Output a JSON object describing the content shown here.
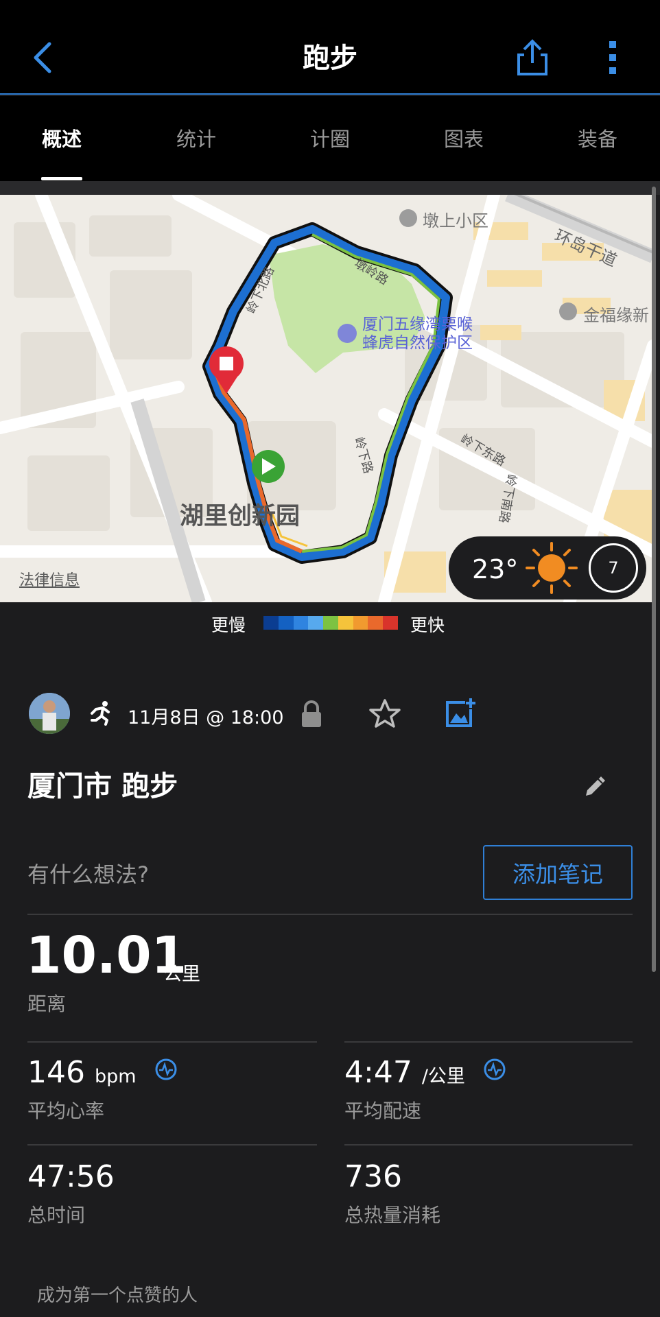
{
  "header": {
    "title": "跑步"
  },
  "tabs": [
    {
      "label": "概述"
    },
    {
      "label": "统计"
    },
    {
      "label": "计圈"
    },
    {
      "label": "图表"
    },
    {
      "label": "装备"
    }
  ],
  "map": {
    "labels": {
      "residential_1": "墩上小区",
      "highway": "环岛干道",
      "residential_2": "金福缘新",
      "park_line1": "厦门五缘湾栗喉",
      "park_line2": "蜂虎自然保护区",
      "road_1": "墩岭路",
      "road_2": "岭下北路",
      "road_3": "岭下东路",
      "road_4": "岭下路",
      "road_5": "岭下南路",
      "area": "湖里创新园"
    },
    "legal": "法律信息"
  },
  "weather": {
    "temperature": "23°",
    "wind": "7"
  },
  "legend": {
    "slow": "更慢",
    "fast": "更快",
    "colors": [
      "#0b3d91",
      "#1461c2",
      "#2f84e0",
      "#57a9ee",
      "#7cc242",
      "#f5c33b",
      "#f19a2f",
      "#e9692c",
      "#d9342b"
    ]
  },
  "activity": {
    "datetime": "11月8日 @ 18:00",
    "title": "厦门市 跑步",
    "thoughts_placeholder": "有什么想法?",
    "add_note": "添加笔记"
  },
  "stats": {
    "distance": {
      "value": "10.01",
      "unit": "公里",
      "label": "距离"
    },
    "heart_rate": {
      "value": "146",
      "unit": "bpm",
      "label": "平均心率"
    },
    "pace": {
      "value": "4:47",
      "unit": "/公里",
      "label": "平均配速"
    },
    "time": {
      "value": "47:56",
      "label": "总时间"
    },
    "calories": {
      "value": "736",
      "label": "总热量消耗"
    }
  },
  "likes": "成为第一个点赞的人",
  "colors": {
    "accent": "#2f7fd6",
    "background": "#1c1c1e"
  }
}
